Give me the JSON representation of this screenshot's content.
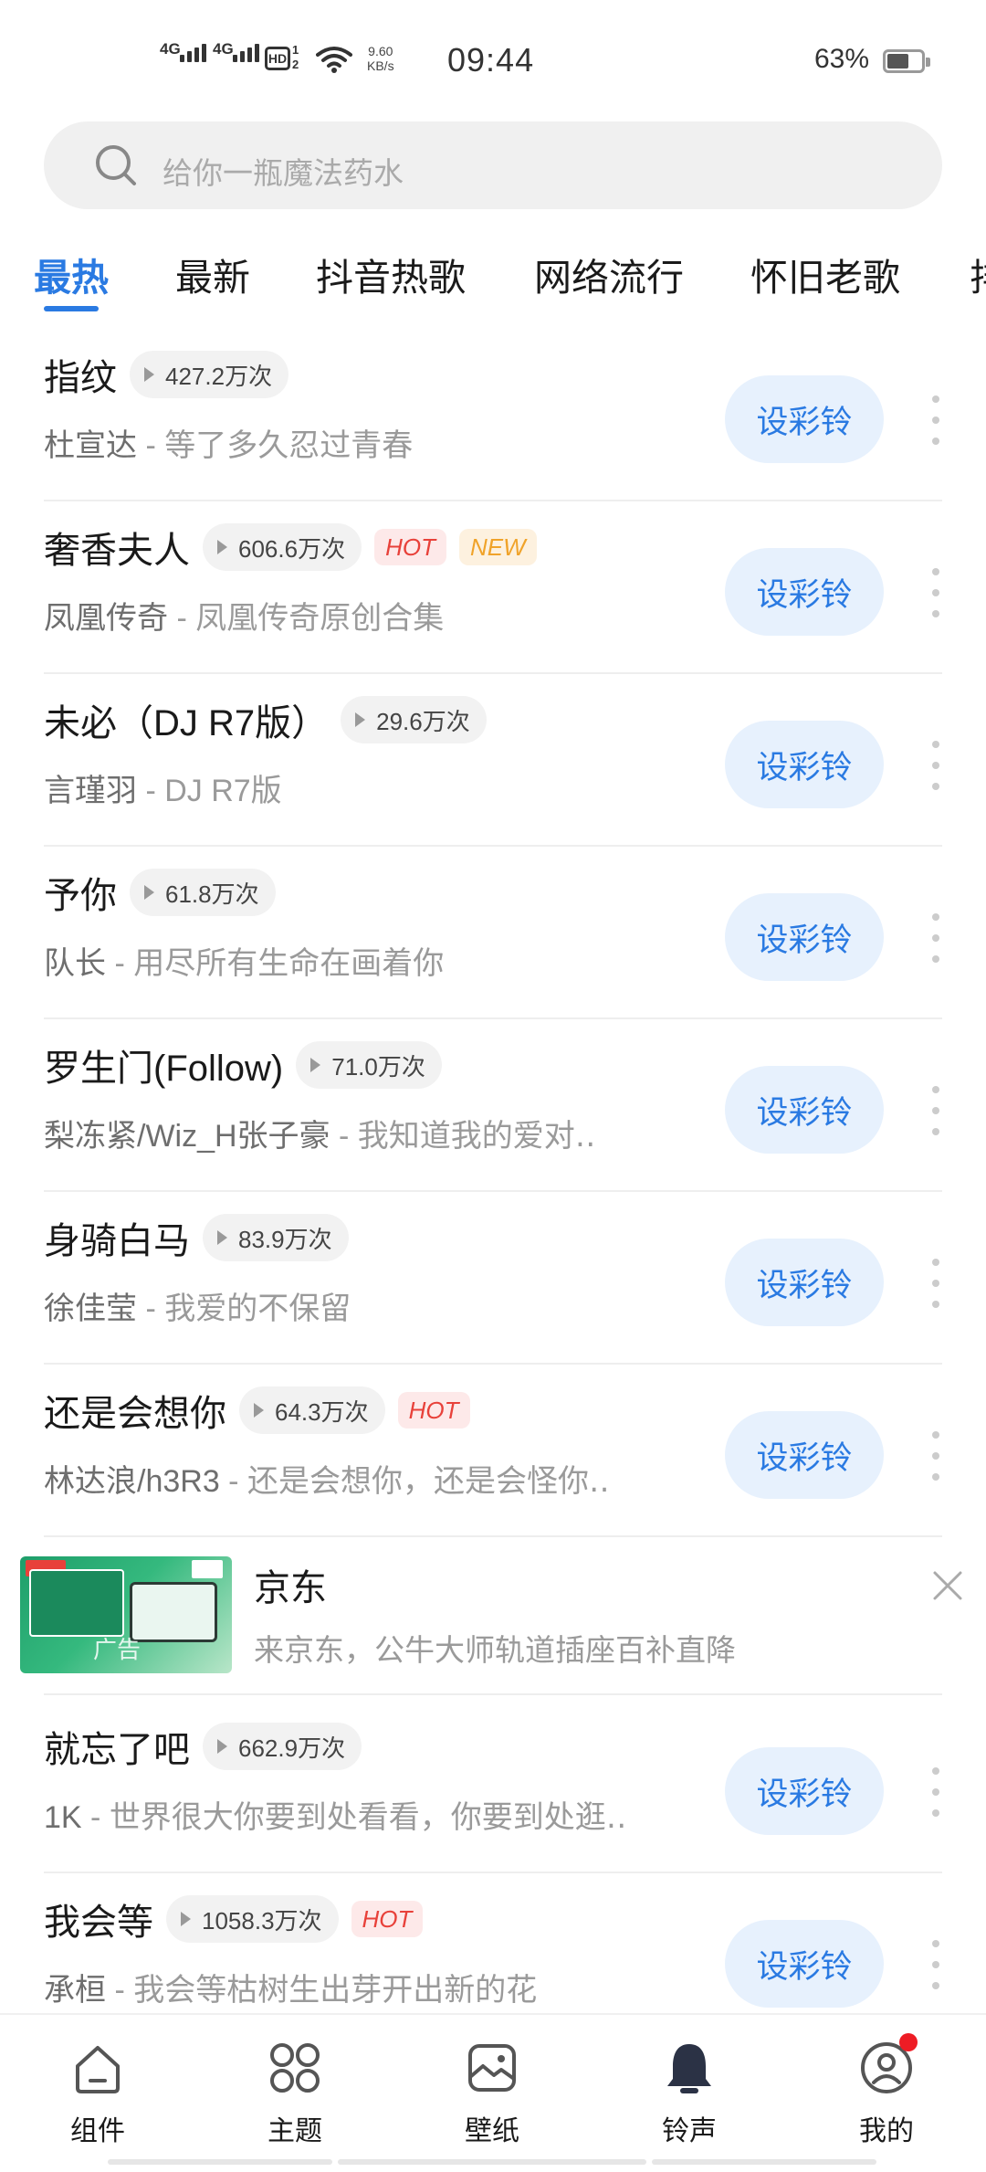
{
  "status_bar": {
    "sim1": "4G",
    "sim2": "4G",
    "hd_label": "HD",
    "hd_sub1": "1",
    "hd_sub2": "2",
    "speed_value": "9.60",
    "speed_unit": "KB/s",
    "time": "09:44",
    "battery_pct": "63%",
    "battery_level": 0.63
  },
  "search": {
    "placeholder": "给你一瓶魔法药水"
  },
  "tabs": [
    {
      "label": "最热",
      "active": true
    },
    {
      "label": "最新"
    },
    {
      "label": "抖音热歌"
    },
    {
      "label": "网络流行"
    },
    {
      "label": "怀旧老歌"
    },
    {
      "label": "排"
    }
  ],
  "action_label": "设彩铃",
  "songs": [
    {
      "title": "指纹",
      "plays": "427.2万次",
      "artist": "杜宣达",
      "sep": " - ",
      "album": "等了多久忍过青春"
    },
    {
      "title": "奢香夫人",
      "plays": "606.6万次",
      "tag_hot": "HOT",
      "tag_new": "NEW",
      "artist": "凤凰传奇",
      "sep": " - ",
      "album": "凤凰传奇原创合集"
    },
    {
      "title": "未必（DJ R7版）",
      "plays": "29.6万次",
      "artist": "言瑾羽",
      "sep": " - ",
      "album": "DJ R7版"
    },
    {
      "title": "予你",
      "plays": "61.8万次",
      "artist": "队长",
      "sep": " - ",
      "album": "用尽所有生命在画着你"
    },
    {
      "title": "罗生门(Follow)",
      "plays": "71.0万次",
      "artist": "梨冻紧/Wiz_H张子豪",
      "sep": " - ",
      "album": "我知道我的爱对‥"
    },
    {
      "title": "身骑白马",
      "plays": "83.9万次",
      "artist": "徐佳莹",
      "sep": " - ",
      "album": "我爱的不保留"
    },
    {
      "title": "还是会想你",
      "plays": "64.3万次",
      "tag_hot": "HOT",
      "artist": "林达浪/h3R3",
      "sep": " - ",
      "album": "还是会想你，还是会怪你‥"
    },
    {
      "title": "就忘了吧",
      "plays": "662.9万次",
      "artist": "1K",
      "sep": " - ",
      "album": "世界很大你要到处看看，你要到处逛‥"
    },
    {
      "title": "我会等",
      "plays": "1058.3万次",
      "tag_hot": "HOT",
      "artist": "承桓",
      "sep": " - ",
      "album": "我会等枯树生出芽开出新的花"
    }
  ],
  "ad": {
    "brand": "京东",
    "description": "来京东，公牛大师轨道插座百补直降",
    "image_label": "广告"
  },
  "bottom_nav": [
    {
      "label": "组件",
      "icon": "widget-icon"
    },
    {
      "label": "主题",
      "icon": "theme-icon"
    },
    {
      "label": "壁纸",
      "icon": "wallpaper-icon"
    },
    {
      "label": "铃声",
      "icon": "bell-icon",
      "active": true
    },
    {
      "label": "我的",
      "icon": "profile-icon",
      "badge": true
    }
  ],
  "colors": {
    "accent": "#2a7ae2",
    "hot": "#e8413a",
    "new": "#f0a32a",
    "button_bg": "#e7f1fd"
  }
}
